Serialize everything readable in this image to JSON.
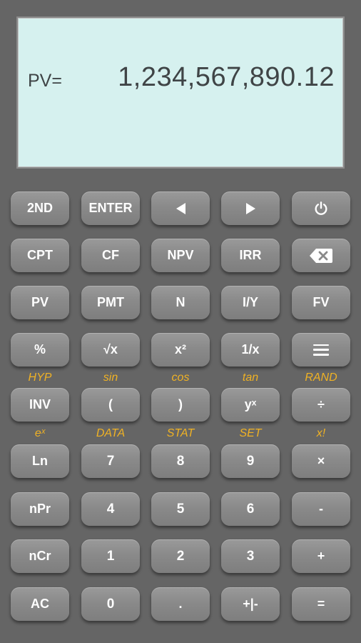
{
  "display": {
    "label": "PV=",
    "value": "1,234,567,890.12",
    "background": "#d6f1ef"
  },
  "colors": {
    "body": "#656565",
    "key": "#8a8a8a",
    "key_text": "#ffffff",
    "secondary_label": "#f0b224"
  },
  "rows": {
    "r1": [
      "2ND",
      "ENTER",
      "left-arrow-icon",
      "right-arrow-icon",
      "power-icon"
    ],
    "r2": [
      "CPT",
      "CF",
      "NPV",
      "IRR",
      "backspace-icon"
    ],
    "r3": [
      "PV",
      "PMT",
      "N",
      "I/Y",
      "FV"
    ],
    "r4": [
      "%",
      "√x",
      "x²",
      "1/x",
      "menu-icon"
    ],
    "r5": [
      "INV",
      "(",
      ")",
      "yˣ",
      "÷"
    ],
    "r6": [
      "Ln",
      "7",
      "8",
      "9",
      "×"
    ],
    "r7": [
      "nPr",
      "4",
      "5",
      "6",
      "-"
    ],
    "r8": [
      "nCr",
      "1",
      "2",
      "3",
      "+"
    ],
    "r9": [
      "AC",
      "0",
      ".",
      "+|-",
      "="
    ]
  },
  "secondary": {
    "above_r5": [
      "HYP",
      "sin",
      "cos",
      "tan",
      "RAND"
    ],
    "above_r6": [
      "eˣ",
      "DATA",
      "STAT",
      "SET",
      "x!"
    ]
  }
}
